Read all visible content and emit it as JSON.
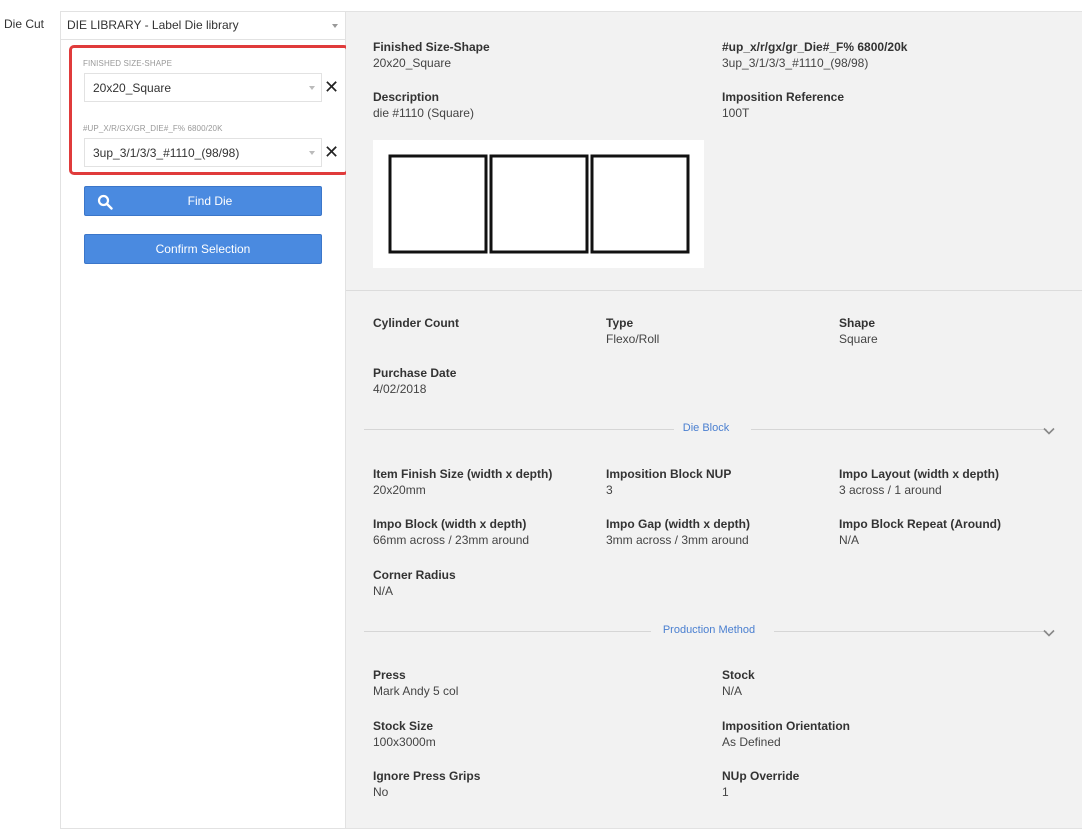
{
  "field_label": "Die Cut",
  "library_select": {
    "value": "DIE LIBRARY - Label Die library"
  },
  "filters": {
    "size_shape": {
      "label": "FINISHED SIZE-SHAPE",
      "value": "20x20_Square"
    },
    "die_code": {
      "label": "#UP_X/R/GX/GR_DIE#_F% 6800/20K",
      "value": "3up_3/1/3/3_#1110_(98/98)"
    }
  },
  "buttons": {
    "find_die": "Find Die",
    "confirm": "Confirm Selection"
  },
  "summary": {
    "finished_size_shape": {
      "label": "Finished Size-Shape",
      "value": "20x20_Square"
    },
    "die_code": {
      "label": "#up_x/r/gx/gr_Die#_F% 6800/20k",
      "value": "3up_3/1/3/3_#1110_(98/98)"
    },
    "description": {
      "label": "Description",
      "value": "die #1110 (Square)"
    },
    "imposition_reference": {
      "label": "Imposition Reference",
      "value": "100T"
    }
  },
  "die_preview": {
    "shape": "square",
    "count": 3
  },
  "details": {
    "cylinder_count": {
      "label": "Cylinder Count",
      "value": ""
    },
    "type": {
      "label": "Type",
      "value": "Flexo/Roll"
    },
    "shape": {
      "label": "Shape",
      "value": "Square"
    },
    "purchase_date": {
      "label": "Purchase Date",
      "value": "4/02/2018"
    }
  },
  "die_block": {
    "title": "Die Block",
    "item_finish_size": {
      "label": "Item Finish Size (width x depth)",
      "value": "20x20mm"
    },
    "imposition_block_nup": {
      "label": "Imposition Block NUP",
      "value": "3"
    },
    "impo_layout": {
      "label": "Impo Layout (width x depth)",
      "value": "3 across / 1 around"
    },
    "impo_block": {
      "label": "Impo Block (width x depth)",
      "value": "66mm across / 23mm around"
    },
    "impo_gap": {
      "label": "Impo Gap (width x depth)",
      "value": "3mm across / 3mm around"
    },
    "impo_block_repeat": {
      "label": "Impo Block Repeat (Around)",
      "value": "N/A"
    },
    "corner_radius": {
      "label": "Corner Radius",
      "value": "N/A"
    }
  },
  "production_method": {
    "title": "Production Method",
    "press": {
      "label": "Press",
      "value": "Mark Andy 5 col"
    },
    "stock": {
      "label": "Stock",
      "value": "N/A"
    },
    "stock_size": {
      "label": "Stock Size",
      "value": "100x3000m"
    },
    "imposition_orientation": {
      "label": "Imposition Orientation",
      "value": "As Defined"
    },
    "ignore_press_grips": {
      "label": "Ignore Press Grips",
      "value": "No"
    },
    "nup_override": {
      "label": "NUp Override",
      "value": "1"
    }
  },
  "colors": {
    "accent": "#4a8ae0",
    "highlight": "#e03b3b",
    "section_title": "#4a7fd0",
    "panel_bg": "#f2f2f2"
  }
}
